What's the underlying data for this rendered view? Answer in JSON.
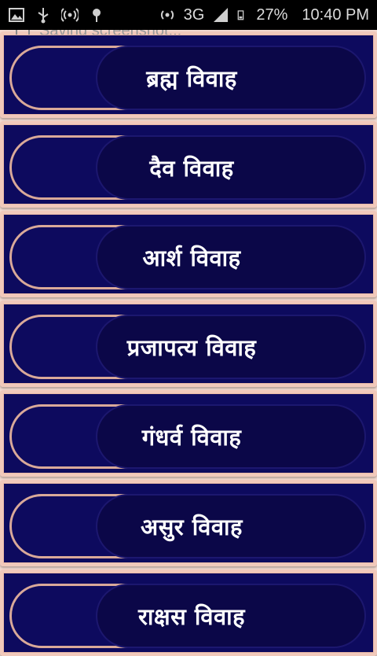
{
  "status_bar": {
    "network": "3G",
    "battery": "27%",
    "time": "10:40 PM",
    "icons": [
      "gallery-icon",
      "usb-icon",
      "hotspot-icon",
      "location-pin-icon",
      "wifi-hotspot-icon",
      "signal-icon",
      "battery-icon"
    ]
  },
  "notification": {
    "text": "Saving screenshot..."
  },
  "colors": {
    "item_background": "#0d0a5e",
    "item_border": "#f1c9bb",
    "label_text": "#ffffff"
  },
  "menu": {
    "items": [
      {
        "label": "ब्रह्म विवाह"
      },
      {
        "label": "दैव विवाह"
      },
      {
        "label": "आर्श विवाह"
      },
      {
        "label": "प्रजापत्य विवाह"
      },
      {
        "label": "गंधर्व विवाह"
      },
      {
        "label": "असुर विवाह"
      },
      {
        "label": "राक्षस विवाह"
      }
    ]
  }
}
